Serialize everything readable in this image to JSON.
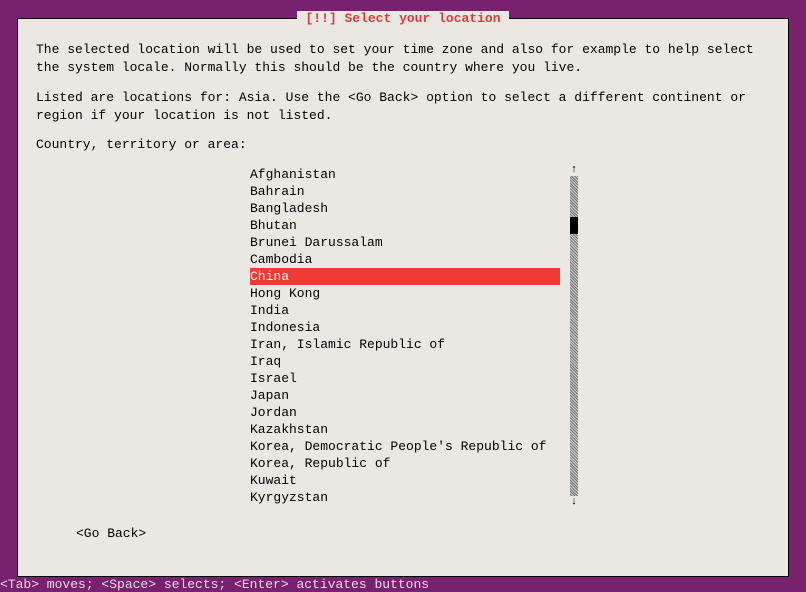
{
  "dialog": {
    "title": "[!!] Select your location",
    "description1": "The selected location will be used to set your time zone and also for example to help select the system locale. Normally this should be the country where you live.",
    "description2": "Listed are locations for: Asia. Use the <Go Back> option to select a different continent or region if your location is not listed.",
    "prompt": "Country, territory or area:",
    "selectedIndex": 6,
    "items": [
      "Afghanistan",
      "Bahrain",
      "Bangladesh",
      "Bhutan",
      "Brunei Darussalam",
      "Cambodia",
      "China",
      "Hong Kong",
      "India",
      "Indonesia",
      "Iran, Islamic Republic of",
      "Iraq",
      "Israel",
      "Japan",
      "Jordan",
      "Kazakhstan",
      "Korea, Democratic People's Republic of",
      "Korea, Republic of",
      "Kuwait",
      "Kyrgyzstan"
    ],
    "goBack": "<Go Back>"
  },
  "statusBar": "<Tab> moves; <Space> selects; <Enter> activates buttons"
}
